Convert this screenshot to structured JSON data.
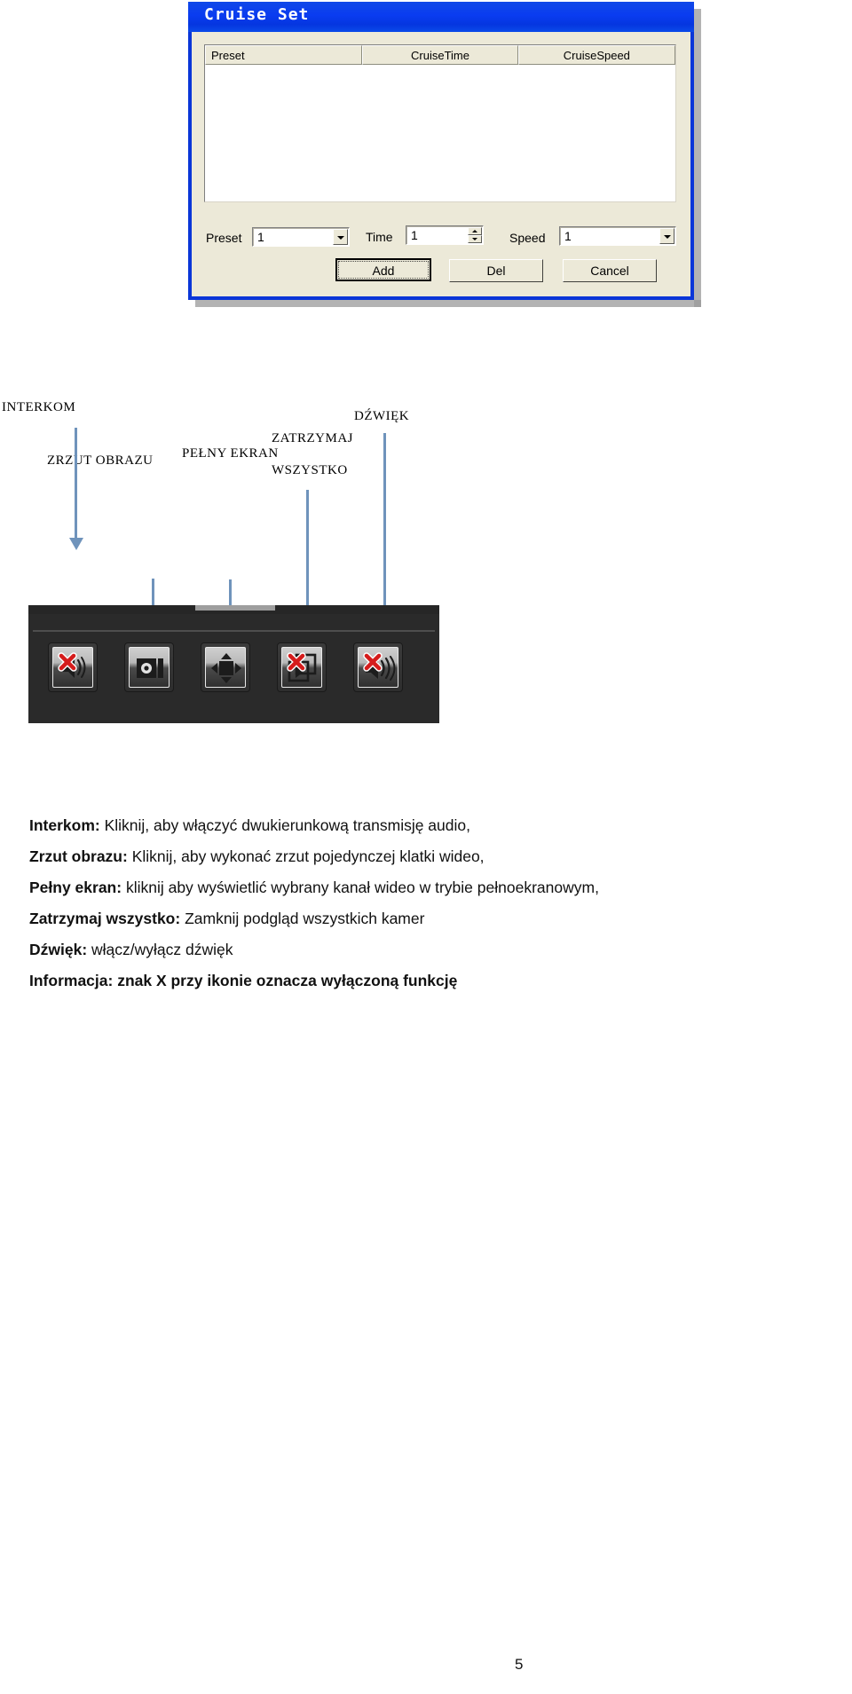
{
  "dialog": {
    "title": "Cruise Set",
    "columns": [
      "Preset",
      "CruiseTime",
      "CruiseSpeed"
    ],
    "rows": [],
    "fields": {
      "preset_label": "Preset",
      "preset_value": "1",
      "time_label": "Time",
      "time_value": "1",
      "speed_label": "Speed",
      "speed_value": "1"
    },
    "buttons": {
      "add": "Add",
      "del": "Del",
      "cancel": "Cancel"
    }
  },
  "callouts": [
    {
      "label": "INTERKOM"
    },
    {
      "label": "ZRZUT  OBRAZU"
    },
    {
      "label": "PEŁNY  EKRAN"
    },
    {
      "label": "ZATRZYMAJ"
    },
    {
      "label": "WSZYSTKO"
    },
    {
      "label": "DŹWIĘK"
    }
  ],
  "toolbar": {
    "icons": [
      {
        "name": "intercom-muted-icon"
      },
      {
        "name": "snapshot-icon"
      },
      {
        "name": "fullscreen-icon"
      },
      {
        "name": "stop-all-muted-icon"
      },
      {
        "name": "sound-muted-icon"
      }
    ]
  },
  "description": {
    "lines": [
      {
        "term": "Interkom:",
        "text": " Kliknij, aby włączyć dwukierunkową transmisję audio,"
      },
      {
        "term": "Zrzut obrazu:",
        "text": " Kliknij, aby wykonać zrzut pojedynczej klatki wideo,"
      },
      {
        "term": "Pełny ekran:",
        "text": " kliknij aby wyświetlić wybrany kanał wideo w trybie pełnoekranowym,"
      },
      {
        "term": "Zatrzymaj wszystko:",
        "text": " Zamknij podgląd wszystkich kamer"
      },
      {
        "term": "Dźwięk:",
        "text": " włącz/wyłącz dźwięk"
      },
      {
        "term": "Informacja: znak X przy ikonie oznacza wyłączoną funkcję",
        "text": ""
      }
    ]
  },
  "footer": {
    "page_number": "5"
  },
  "colors": {
    "titlebar": "#0a3cf0",
    "dialog_face": "#ece9d8",
    "callout_line": "#6f93bb",
    "red_x": "#d51c1c",
    "toolbar_bg": "#2a2a2a"
  }
}
